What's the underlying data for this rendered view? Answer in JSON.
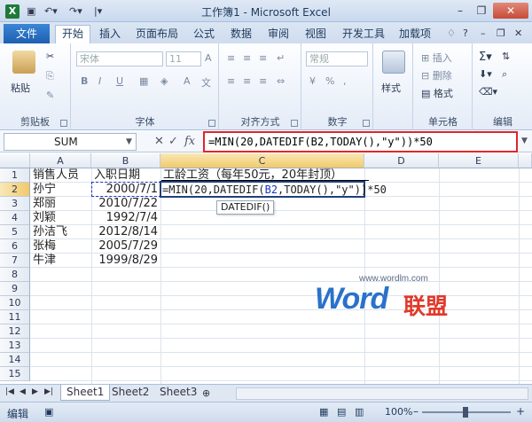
{
  "window": {
    "title": "工作簿1 - Microsoft Excel",
    "app_icon": "X"
  },
  "ribbon": {
    "file_tab": "文件",
    "tabs": [
      "开始",
      "插入",
      "页面布局",
      "公式",
      "数据",
      "审阅",
      "视图",
      "开发工具",
      "加载项"
    ],
    "active_tab": "开始",
    "groups": {
      "clipboard": {
        "label": "剪贴板",
        "paste": "粘贴"
      },
      "font": {
        "label": "字体",
        "font_name": "宋体",
        "font_size": "11"
      },
      "alignment": {
        "label": "对齐方式"
      },
      "number": {
        "label": "数字",
        "format": "常规"
      },
      "styles": {
        "label": "样式",
        "button": "样式"
      },
      "cells": {
        "label": "单元格",
        "insert": "插入",
        "delete": "删除",
        "format": "格式"
      },
      "editing": {
        "label": "编辑"
      }
    }
  },
  "formula_bar": {
    "name_box": "SUM",
    "formula": "=MIN(20,DATEDIF(B2,TODAY(),\"y\"))*50"
  },
  "sheet": {
    "columns": [
      "A",
      "B",
      "C",
      "D",
      "E"
    ],
    "rows": [
      "1",
      "2",
      "3",
      "4",
      "5",
      "6",
      "7",
      "8",
      "9",
      "10",
      "11",
      "12",
      "13",
      "14",
      "15"
    ],
    "active_column": "C",
    "active_row": "2",
    "header_row": {
      "a": "销售人员",
      "b": "入职日期",
      "c": "工龄工资（每年50元，20年封顶）"
    },
    "data": [
      {
        "name": "孙宁",
        "date": "2000/7/1"
      },
      {
        "name": "郑丽",
        "date": "2010/7/22"
      },
      {
        "name": "刘颖",
        "date": "1992/7/4"
      },
      {
        "name": "孙洁飞",
        "date": "2012/8/14"
      },
      {
        "name": "张梅",
        "date": "2005/7/29"
      },
      {
        "name": "牛津",
        "date": "1999/8/29"
      }
    ],
    "editing_formula": {
      "prefix": "=MIN(20,DATEDIF(",
      "ref": "B2",
      "middle": ",TODAY(),",
      "arg": "\"y\"",
      "suffix": "))*50"
    },
    "tooltip": "DATEDIF()"
  },
  "sheet_tabs": [
    "Sheet1",
    "Sheet2",
    "Sheet3"
  ],
  "status": {
    "mode": "编辑",
    "zoom": "100%"
  },
  "watermark": {
    "url": "www.wordlm.com",
    "logo": "Word",
    "cn": "联盟"
  }
}
